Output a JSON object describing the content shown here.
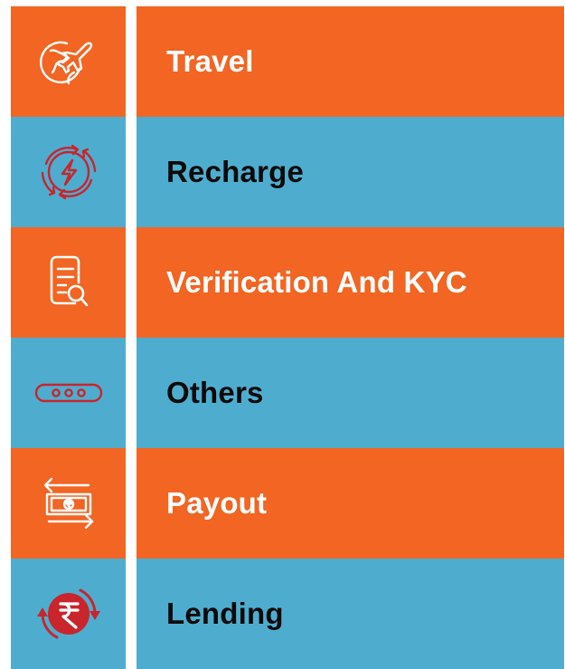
{
  "colors": {
    "orange": "#f26522",
    "blue": "#4eadcf",
    "white": "#ffffff",
    "dark_text": "#0a0a0a",
    "red_icon": "#c8252c"
  },
  "menu": {
    "items": [
      {
        "label": "Travel",
        "icon": "globe-plane-icon",
        "bg": "orange"
      },
      {
        "label": "Recharge",
        "icon": "recharge-bolt-icon",
        "bg": "blue"
      },
      {
        "label": "Verification And KYC",
        "icon": "document-search-icon",
        "bg": "orange"
      },
      {
        "label": "Others",
        "icon": "more-dots-icon",
        "bg": "blue"
      },
      {
        "label": "Payout",
        "icon": "payout-transfer-icon",
        "bg": "orange"
      },
      {
        "label": "Lending",
        "icon": "rupee-cycle-icon",
        "bg": "blue"
      }
    ]
  }
}
